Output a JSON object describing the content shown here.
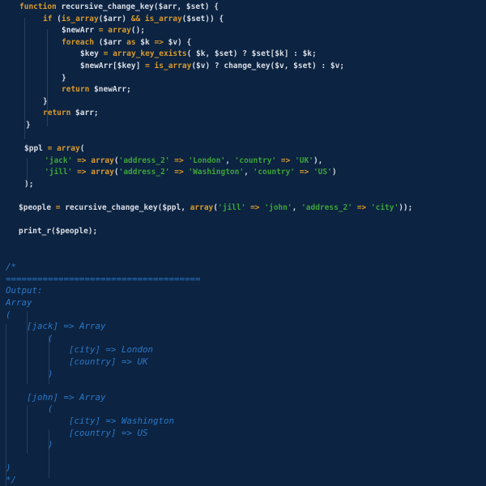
{
  "editor": {
    "colors": {
      "background": "#0c2341",
      "text": "#d9dee6",
      "keyword": "#d99a2b",
      "string": "#3da33a",
      "comment": "#2a78c8"
    },
    "code_lines": [
      [
        [
          "kw",
          "function"
        ],
        [
          "t",
          " recursive_change_key($arr, $set) {"
        ]
      ],
      [
        [
          "kw",
          "if"
        ],
        [
          "t",
          " ("
        ],
        [
          "kw",
          "is_array"
        ],
        [
          "t",
          "($arr) "
        ],
        [
          "kw",
          "&&"
        ],
        [
          "t",
          " "
        ],
        [
          "kw",
          "is_array"
        ],
        [
          "t",
          "($set)) {"
        ]
      ],
      [
        [
          "t",
          "$newArr "
        ],
        [
          "kw",
          "="
        ],
        [
          "t",
          " "
        ],
        [
          "kw",
          "array"
        ],
        [
          "t",
          "();"
        ]
      ],
      [
        [
          "kw",
          "foreach"
        ],
        [
          "t",
          " ($arr "
        ],
        [
          "kw",
          "as"
        ],
        [
          "t",
          " $k "
        ],
        [
          "kw",
          "=>"
        ],
        [
          "t",
          " $v) {"
        ]
      ],
      [
        [
          "t",
          "$key "
        ],
        [
          "kw",
          "="
        ],
        [
          "t",
          " "
        ],
        [
          "kw",
          "array_key_exists"
        ],
        [
          "t",
          "( $k, $set) ? $set[$k] : $k;"
        ]
      ],
      [
        [
          "t",
          "$newArr[$key] "
        ],
        [
          "kw",
          "="
        ],
        [
          "t",
          " "
        ],
        [
          "kw",
          "is_array"
        ],
        [
          "t",
          "($v) ? change_key($v, $set) : $v;"
        ]
      ],
      [
        [
          "t",
          "}"
        ]
      ],
      [
        [
          "kw",
          "return"
        ],
        [
          "t",
          " $newArr;"
        ]
      ],
      [
        [
          "t",
          "}"
        ]
      ],
      [
        [
          "kw",
          "return"
        ],
        [
          "t",
          " $arr;"
        ]
      ],
      [
        [
          "t",
          "}"
        ]
      ],
      [],
      [
        [
          "t",
          "$ppl "
        ],
        [
          "kw",
          "="
        ],
        [
          "t",
          " "
        ],
        [
          "kw",
          "array"
        ],
        [
          "t",
          "("
        ]
      ],
      [
        [
          "str",
          "'jack'"
        ],
        [
          "t",
          " "
        ],
        [
          "kw",
          "=>"
        ],
        [
          "t",
          " "
        ],
        [
          "kw",
          "array"
        ],
        [
          "t",
          "("
        ],
        [
          "str",
          "'address_2'"
        ],
        [
          "t",
          " "
        ],
        [
          "kw",
          "=>"
        ],
        [
          "t",
          " "
        ],
        [
          "str",
          "'London'"
        ],
        [
          "t",
          ", "
        ],
        [
          "str",
          "'country'"
        ],
        [
          "t",
          " "
        ],
        [
          "kw",
          "=>"
        ],
        [
          "t",
          " "
        ],
        [
          "str",
          "'UK'"
        ],
        [
          "t",
          "),"
        ]
      ],
      [
        [
          "str",
          "'jill'"
        ],
        [
          "t",
          " "
        ],
        [
          "kw",
          "=>"
        ],
        [
          "t",
          " "
        ],
        [
          "kw",
          "array"
        ],
        [
          "t",
          "("
        ],
        [
          "str",
          "'address_2'"
        ],
        [
          "t",
          " "
        ],
        [
          "kw",
          "=>"
        ],
        [
          "t",
          " "
        ],
        [
          "str",
          "'Washington'"
        ],
        [
          "t",
          ", "
        ],
        [
          "str",
          "'country'"
        ],
        [
          "t",
          " "
        ],
        [
          "kw",
          "=>"
        ],
        [
          "t",
          " "
        ],
        [
          "str",
          "'US'"
        ],
        [
          "t",
          ")"
        ]
      ],
      [
        [
          "t",
          ");"
        ]
      ],
      [],
      [
        [
          "t",
          "$people "
        ],
        [
          "kw",
          "="
        ],
        [
          "t",
          " recursive_change_key($ppl, "
        ],
        [
          "kw",
          "array"
        ],
        [
          "t",
          "("
        ],
        [
          "str",
          "'jill'"
        ],
        [
          "t",
          " "
        ],
        [
          "kw",
          "=>"
        ],
        [
          "t",
          " "
        ],
        [
          "str",
          "'john'"
        ],
        [
          "t",
          ", "
        ],
        [
          "str",
          "'address_2'"
        ],
        [
          "t",
          " "
        ],
        [
          "kw",
          "=>"
        ],
        [
          "t",
          " "
        ],
        [
          "str",
          "'city'"
        ],
        [
          "t",
          "));"
        ]
      ],
      [],
      [
        [
          "t",
          "print_r($people);"
        ]
      ]
    ],
    "comment_lines": [
      "/*",
      "=====================================",
      "Output:",
      "Array",
      "(",
      "    [jack] => Array",
      "        (",
      "            [city] => London",
      "            [country] => UK",
      "        )",
      "",
      "    [john] => Array",
      "        (",
      "            [city] => Washington",
      "            [country] => US",
      "        )",
      "",
      ")",
      "*/"
    ]
  }
}
